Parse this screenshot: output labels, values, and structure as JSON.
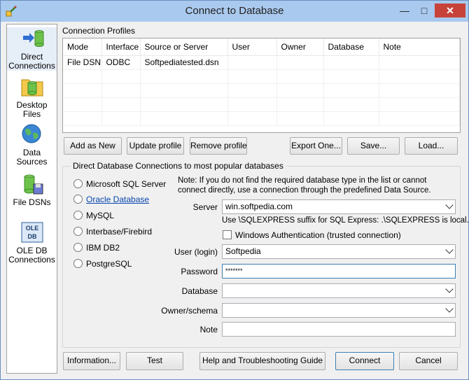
{
  "window": {
    "title": "Connect to Database",
    "minimize": "—",
    "maximize": "□",
    "close": "✕"
  },
  "sidebar": {
    "items": [
      {
        "label_line1": "Direct",
        "label_line2": "Connections",
        "icon": "direct-connections-icon"
      },
      {
        "label_line1": "Desktop",
        "label_line2": "Files",
        "icon": "desktop-files-icon"
      },
      {
        "label_line1": "Data",
        "label_line2": "Sources",
        "icon": "data-sources-icon"
      },
      {
        "label_line1": "File DSNs",
        "label_line2": "",
        "icon": "file-dsn-icon"
      },
      {
        "label_line1": "OLE DB",
        "label_line2": "Connections",
        "icon": "ole-db-icon"
      }
    ]
  },
  "profiles": {
    "title": "Connection Profiles",
    "columns": [
      "Mode",
      "Interface",
      "Source or Server",
      "User",
      "Owner",
      "Database",
      "Note"
    ],
    "rows": [
      [
        "File DSN",
        "ODBC",
        "Softpediatested.dsn",
        "",
        "",
        "",
        ""
      ]
    ]
  },
  "profile_buttons": {
    "add_new": "Add as New",
    "update": "Update profile",
    "remove": "Remove profile",
    "export": "Export One...",
    "save": "Save...",
    "load": "Load..."
  },
  "direct": {
    "group_title": "Direct Database Connections to most popular databases",
    "db_types": [
      "Microsoft SQL Server",
      "Oracle Database",
      "MySQL",
      "Interbase/Firebird",
      "IBM DB2",
      "PostgreSQL"
    ],
    "note": "Note: If you do not find the required database type in the list or cannot connect directly, use a connection through the predefined Data Source.",
    "server_label": "Server",
    "server_value": "win.softpedia.com",
    "server_hint": "Use \\SQLEXPRESS suffix for SQL Express: .\\SQLEXPRESS is local.",
    "windows_auth_label": "Windows Authentication (trusted connection)",
    "user_label": "User (login)",
    "user_value": "Softpedia",
    "password_label": "Password",
    "password_value": "*******",
    "database_label": "Database",
    "database_value": "",
    "owner_label": "Owner/schema",
    "owner_value": "",
    "note_label": "Note",
    "note_value": ""
  },
  "footer": {
    "information": "Information...",
    "test": "Test",
    "help": "Help and Troubleshooting Guide",
    "connect": "Connect",
    "cancel": "Cancel"
  }
}
